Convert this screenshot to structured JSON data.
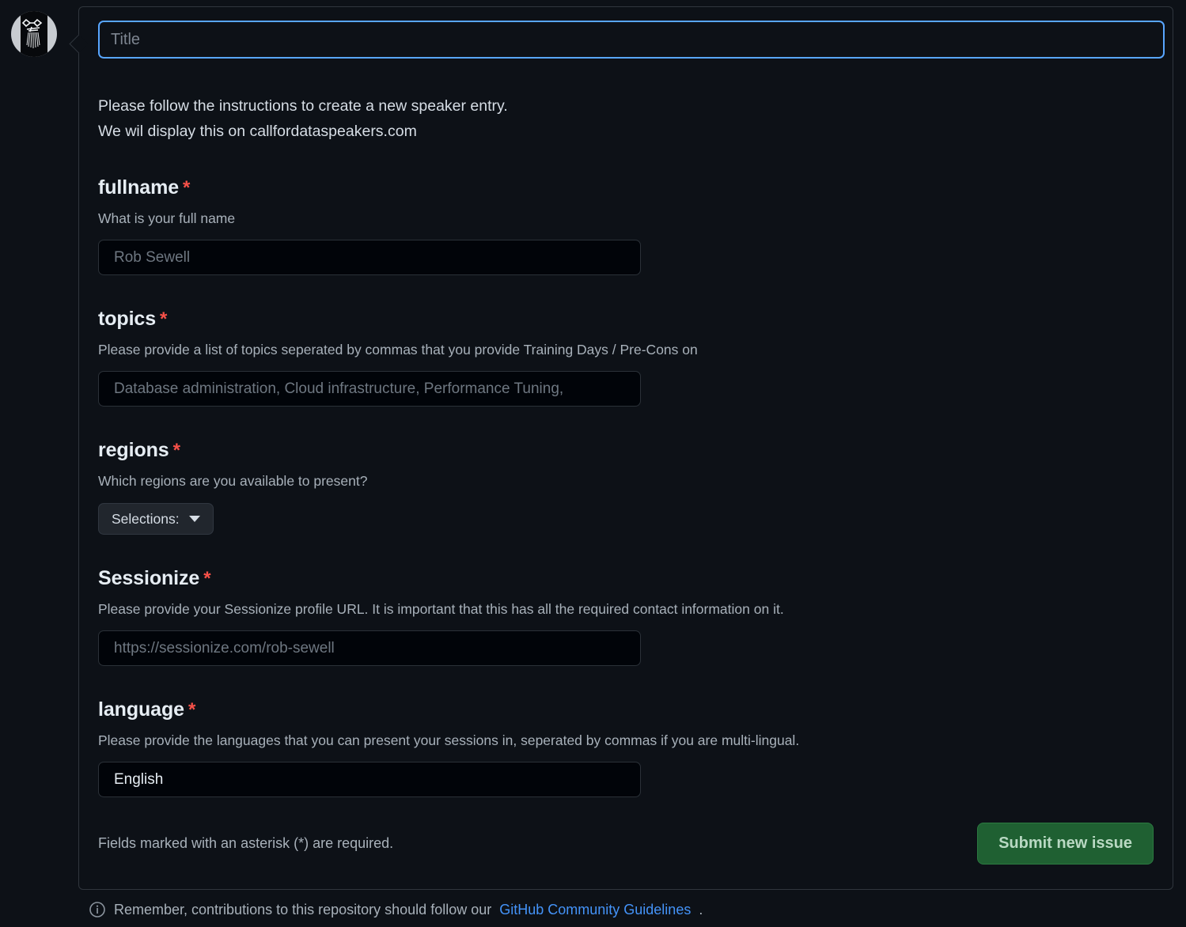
{
  "avatar": {
    "name": "user-avatar"
  },
  "title_field": {
    "placeholder": "Title",
    "value": ""
  },
  "intro": {
    "line1": "Please follow the instructions to create a new speaker entry.",
    "line2": "We wil display this on callfordataspeakers.com"
  },
  "required_marker": "*",
  "fields": [
    {
      "name": "fullname",
      "label": "fullname",
      "description": "What is your full name",
      "placeholder": "Rob Sewell",
      "value": "",
      "type": "text"
    },
    {
      "name": "topics",
      "label": "topics",
      "description": "Please provide a list of topics seperated by commas that you provide Training Days / Pre-Cons on",
      "placeholder": "Database administration, Cloud infrastructure, Performance Tuning,",
      "value": "",
      "type": "text"
    },
    {
      "name": "regions",
      "label": "regions",
      "description": "Which regions are you available to present?",
      "dropdown_label": "Selections:",
      "type": "dropdown"
    },
    {
      "name": "Sessionize",
      "label": "Sessionize",
      "description": "Please provide your Sessionize profile URL. It is important that this has all the required contact information on it.",
      "placeholder": "https://sessionize.com/rob-sewell",
      "value": "",
      "type": "text"
    },
    {
      "name": "language",
      "label": "language",
      "description": "Please provide the languages that you can present your sessions in, seperated by commas if you are multi-lingual.",
      "placeholder": "English",
      "value": "English",
      "type": "text"
    }
  ],
  "footer": {
    "required_note": "Fields marked with an asterisk (*) are required.",
    "submit_label": "Submit new issue"
  },
  "guidelines": {
    "icon": "info-icon",
    "text_before": "Remember, contributions to this repository should follow our",
    "link_text": "GitHub Community Guidelines",
    "text_after": "."
  },
  "colors": {
    "page_background": "#0d1117",
    "input_background": "#010409",
    "focus_border": "#58a6ff",
    "required_asterisk": "#f85149",
    "submit_green": "#1f6032",
    "link_blue": "#4493f8",
    "border": "#30363d"
  }
}
